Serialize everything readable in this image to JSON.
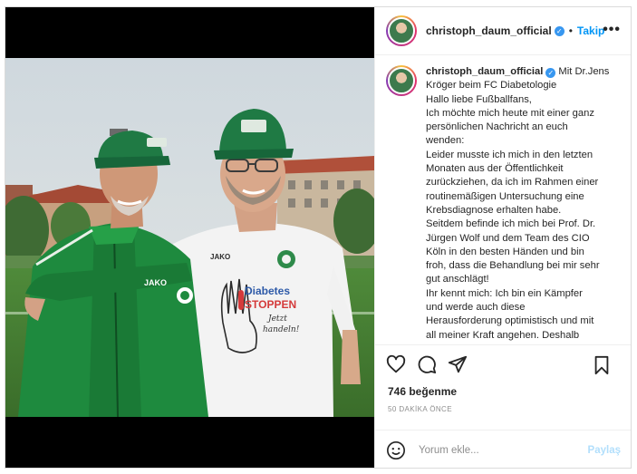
{
  "post": {
    "username": "christoph_daum_official",
    "verified_icon": "verified-badge-icon",
    "separator": "•",
    "follow_label": "Takip",
    "more_label": "•••"
  },
  "caption": {
    "username": "christoph_daum_official",
    "lines": [
      "Mit Dr.Jens",
      "Kröger beim FC Diabetologie",
      "Hallo liebe Fußballfans,",
      "Ich möchte mich heute mit einer ganz",
      "persönlichen Nachricht an euch",
      "wenden:",
      "Leider musste ich mich in den letzten",
      "Monaten aus der Öffentlichkeit",
      "zurückziehen, da ich im Rahmen einer",
      "routinemäßigen Untersuchung eine",
      "Krebsdiagnose erhalten habe.",
      "Seitdem befinde ich mich bei Prof. Dr.",
      "Jürgen Wolf und dem Team des CIO",
      "Köln in den besten Händen und bin",
      "froh, dass die Behandlung bei mir sehr",
      "gut anschlägt!",
      "Ihr kennt mich: Ich bin ein Kämpfer",
      "und werde auch diese",
      "Herausforderung optimistisch und mit",
      "all meiner Kraft angehen. Deshalb"
    ]
  },
  "photo": {
    "shirt_brand_left": "JAKO",
    "shirt_brand_right": "JAKO",
    "shirt_line1": "Diabetes",
    "shirt_line2": "STOPPEN",
    "shirt_script1": "Jetzt",
    "shirt_script2": "handeln!"
  },
  "stats": {
    "likes": "746 beğenme",
    "time": "50 DAKİKA ÖNCE"
  },
  "comment": {
    "placeholder": "Yorum ekle...",
    "post_label": "Paylaş"
  },
  "colors": {
    "accent": "#0095f6",
    "post_disabled": "#b2dffc",
    "jacket_green": "#1e8a3e"
  }
}
